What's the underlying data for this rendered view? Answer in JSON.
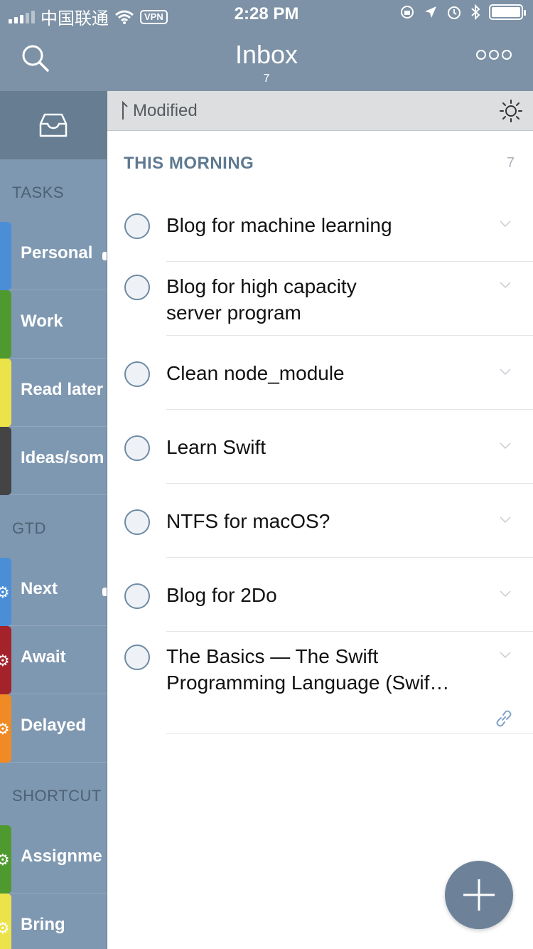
{
  "status_bar": {
    "carrier": "中国联通",
    "vpn": "VPN",
    "time": "2:28 PM"
  },
  "header": {
    "title": "Inbox",
    "count": "7"
  },
  "sidebar": {
    "sections": [
      {
        "heading": "TASKS",
        "items": [
          {
            "label": "Personal",
            "color": "#4a8fd6"
          },
          {
            "label": "Work",
            "color": "#4f9a2e"
          },
          {
            "label": "Read later",
            "color": "#ece34a"
          },
          {
            "label": "Ideas/som",
            "color": "#444444"
          }
        ]
      },
      {
        "heading": "GTD",
        "items": [
          {
            "label": "Next",
            "color": "#4a8fd6"
          },
          {
            "label": "Await",
            "color": "#a4232a"
          },
          {
            "label": "Delayed",
            "color": "#f08a24"
          }
        ]
      },
      {
        "heading": "SHORTCUT",
        "items": [
          {
            "label": "Assignme",
            "color": "#4f9a2e"
          },
          {
            "label": "Bring",
            "color": "#ece34a"
          }
        ]
      }
    ]
  },
  "list": {
    "sort_label": "Modified",
    "section_title": "THIS MORNING",
    "section_count": "7",
    "tasks": [
      {
        "title": "Blog for machine learning"
      },
      {
        "title": "Blog for high capacity server program"
      },
      {
        "title": "Clean node_module"
      },
      {
        "title": "Learn Swift"
      },
      {
        "title": "NTFS for macOS?"
      },
      {
        "title": "Blog for 2Do"
      },
      {
        "title": "The Basics — The Swift Programming Language (Swif…"
      }
    ]
  },
  "colors": {
    "accent": "#6d8299",
    "header_bg": "#7d92a6",
    "sidebar_bg": "#7f98b1"
  },
  "icons": [
    "search-icon",
    "more-icon",
    "inbox-icon",
    "sort-arrow-icon",
    "sun-icon",
    "chevron-down-icon",
    "link-icon",
    "plus-icon",
    "gear-icon",
    "wifi-icon",
    "battery-icon",
    "bluetooth-icon",
    "alarm-icon",
    "location-icon",
    "rotation-lock-icon"
  ]
}
